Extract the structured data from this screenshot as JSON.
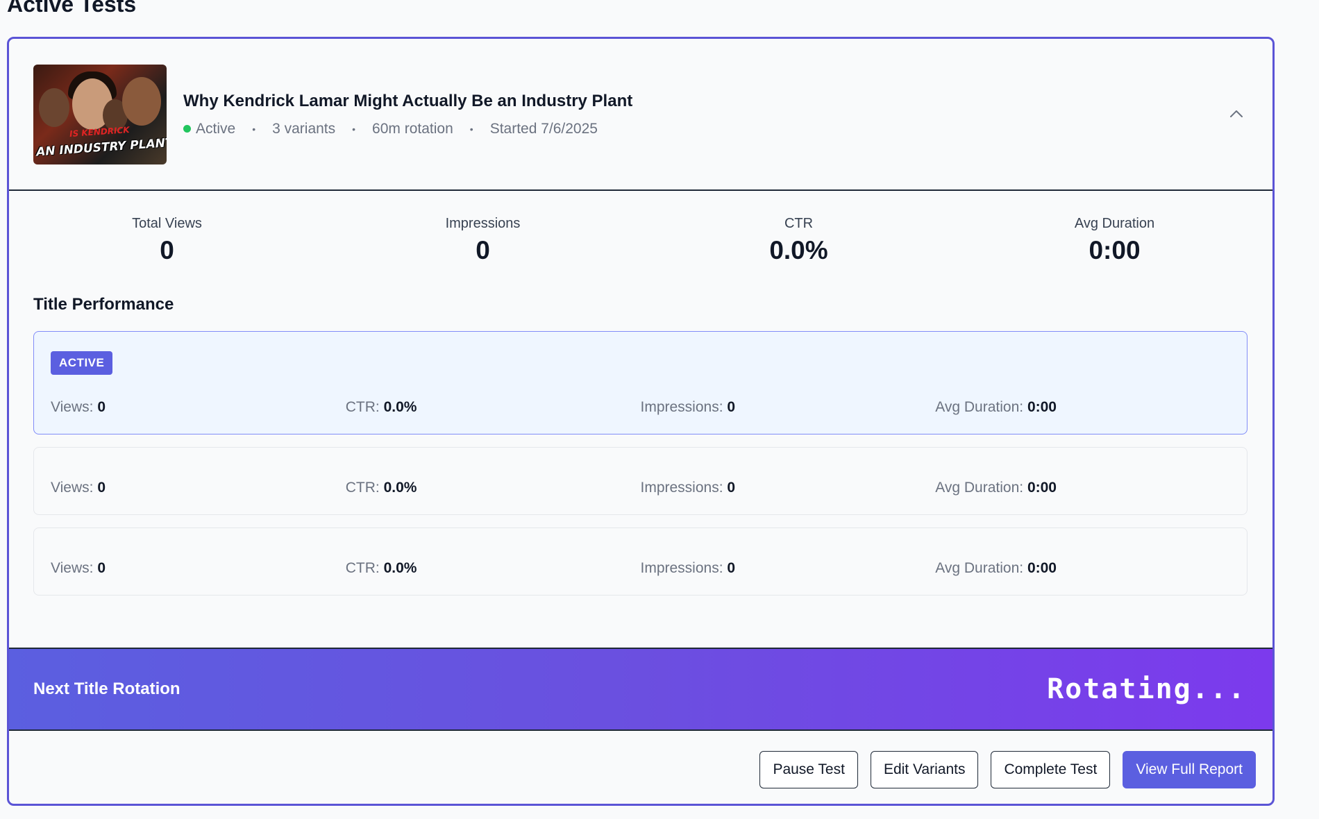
{
  "page": {
    "heading": "Active Tests"
  },
  "test": {
    "video_title": "Why Kendrick Lamar Might Actually Be an Industry Plant",
    "thumbnail": {
      "text": "AN INDUSTRY PLANT?",
      "subtext": "IS KENDRICK"
    },
    "status": "Active",
    "variants": "3 variants",
    "rotation": "60m rotation",
    "started": "Started 7/6/2025",
    "collapse_icon": "chevron-up-icon"
  },
  "stats": [
    {
      "label": "Total Views",
      "value": "0"
    },
    {
      "label": "Impressions",
      "value": "0"
    },
    {
      "label": "CTR",
      "value": "0.0%"
    },
    {
      "label": "Avg Duration",
      "value": "0:00"
    }
  ],
  "title_performance": {
    "heading": "Title Performance",
    "active_badge": "ACTIVE",
    "variants": [
      {
        "views_label": "Views:",
        "views": "0",
        "ctr_label": "CTR:",
        "ctr": "0.0%",
        "impressions_label": "Impressions:",
        "impressions": "0",
        "duration_label": "Avg Duration:",
        "duration": "0:00"
      },
      {
        "views_label": "Views:",
        "views": "0",
        "ctr_label": "CTR:",
        "ctr": "0.0%",
        "impressions_label": "Impressions:",
        "impressions": "0",
        "duration_label": "Avg Duration:",
        "duration": "0:00"
      },
      {
        "views_label": "Views:",
        "views": "0",
        "ctr_label": "CTR:",
        "ctr": "0.0%",
        "impressions_label": "Impressions:",
        "impressions": "0",
        "duration_label": "Avg Duration:",
        "duration": "0:00"
      }
    ]
  },
  "rotation_banner": {
    "label": "Next Title Rotation",
    "status": "Rotating..."
  },
  "actions": {
    "pause": "Pause Test",
    "edit": "Edit Variants",
    "complete": "Complete Test",
    "report": "View Full Report"
  },
  "colors": {
    "accent": "#5b5fe0",
    "gradient_end": "#7c3aed",
    "status_active": "#22c55e"
  }
}
